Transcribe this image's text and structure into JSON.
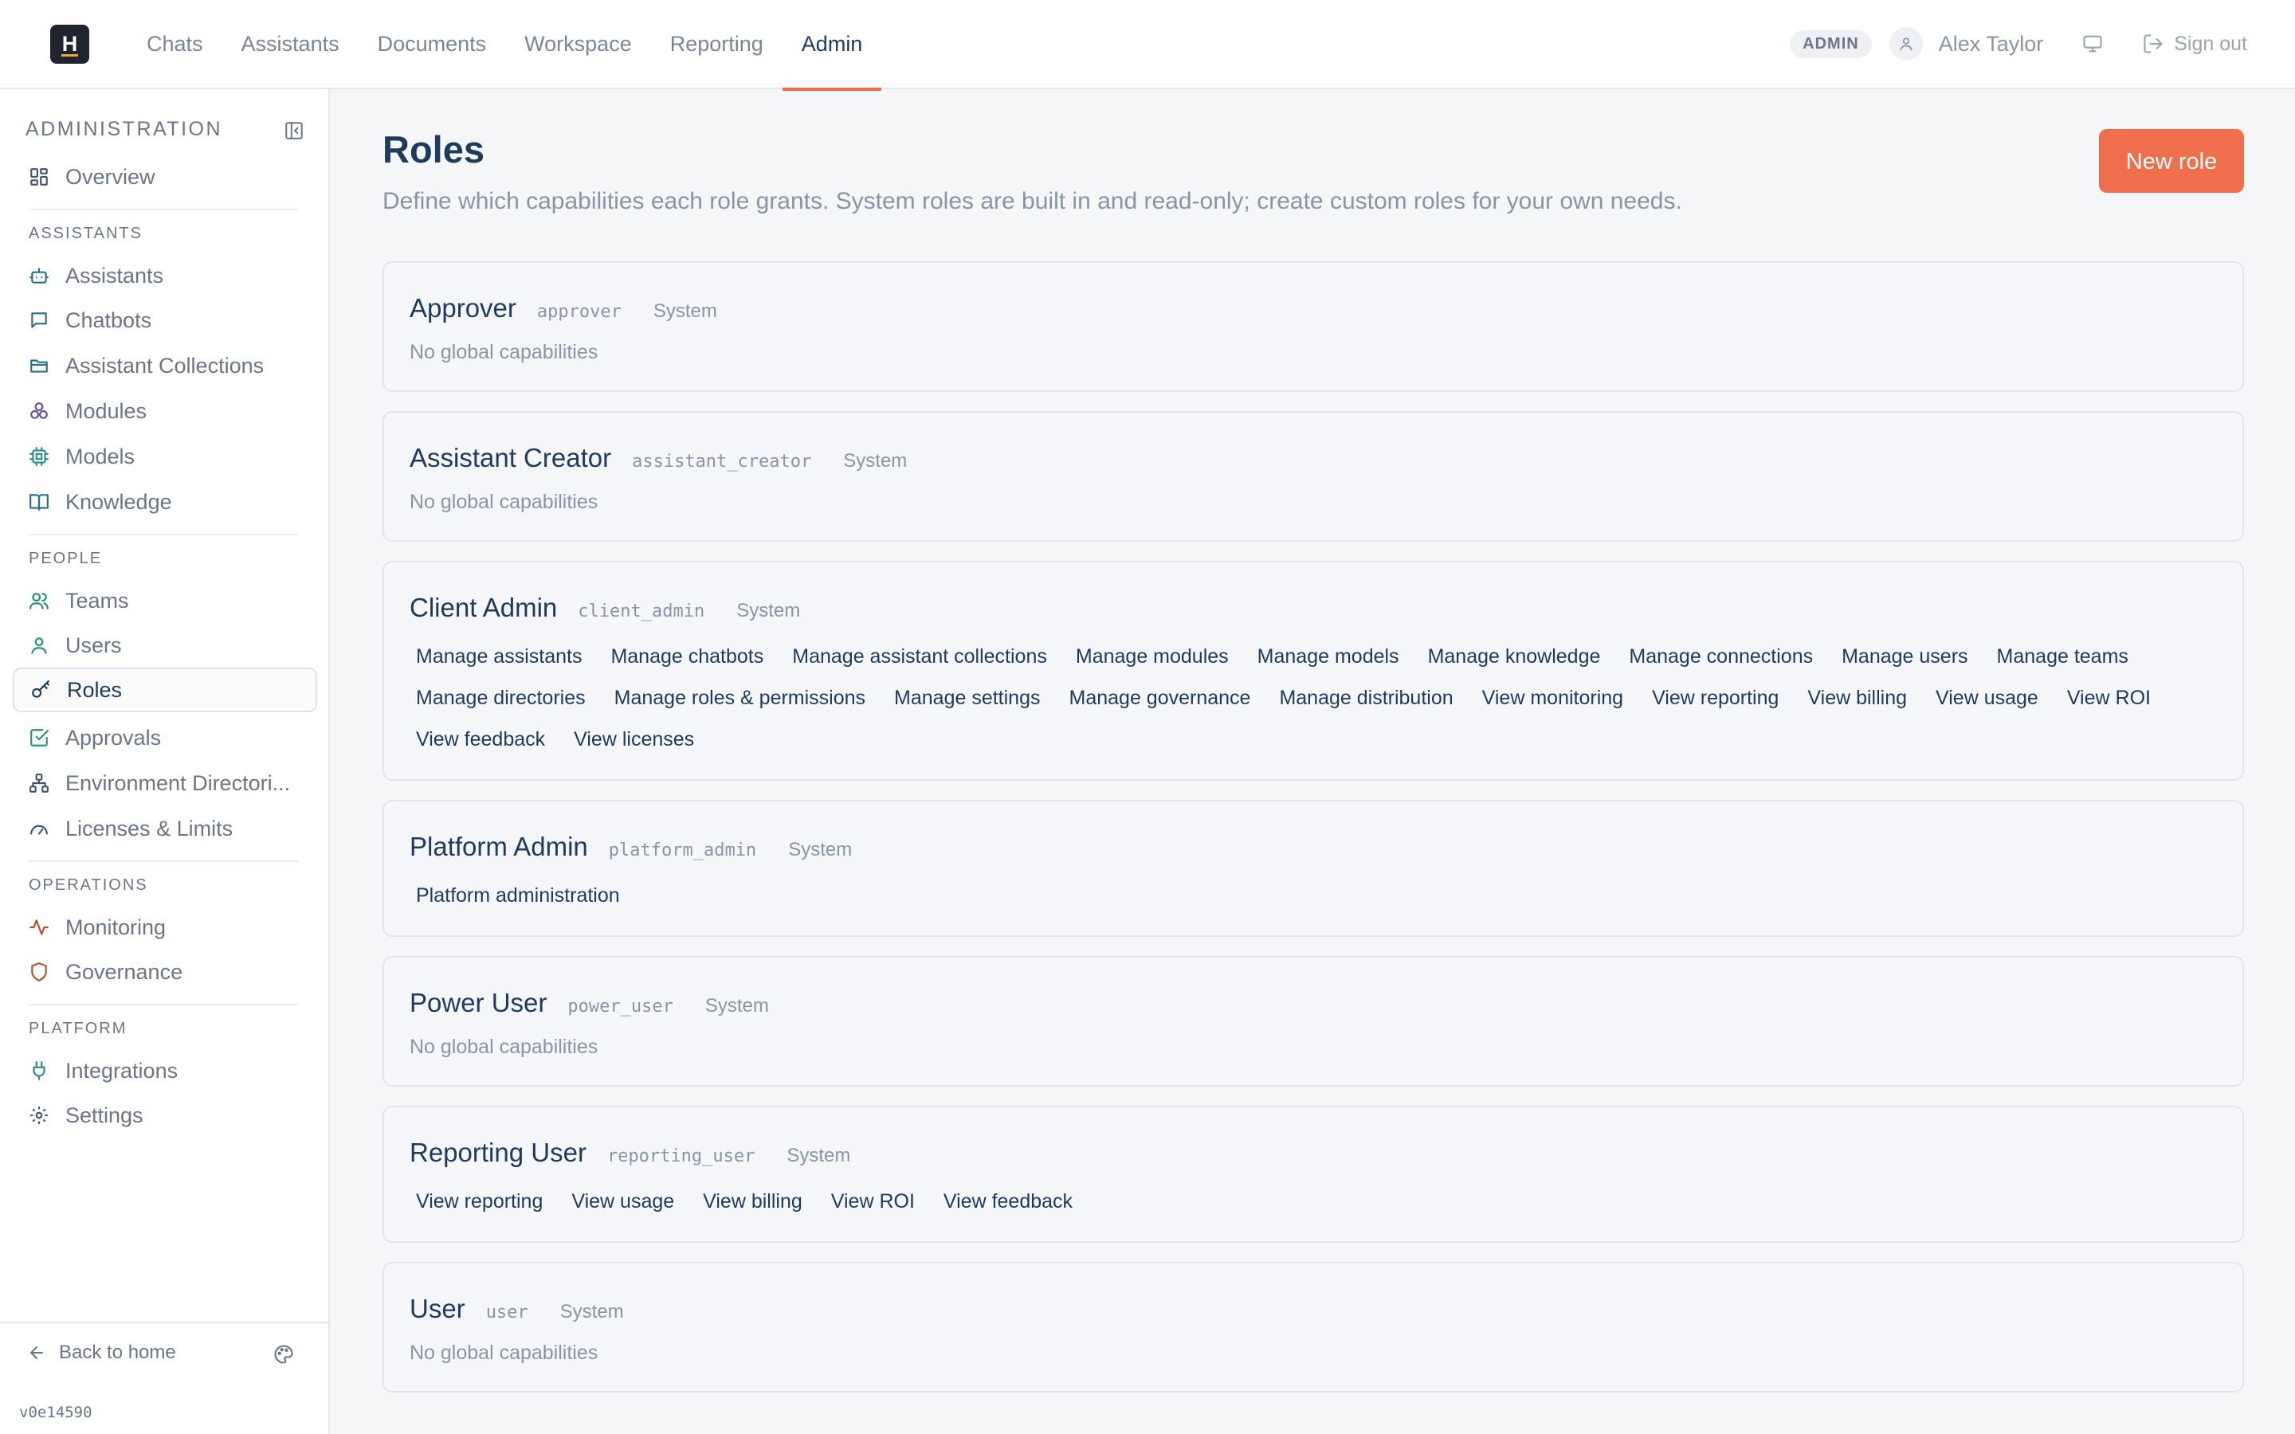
{
  "brand": {
    "logo_letter": "H"
  },
  "nav": {
    "tabs": [
      "Chats",
      "Assistants",
      "Documents",
      "Workspace",
      "Reporting",
      "Admin"
    ],
    "active": "Admin"
  },
  "header_right": {
    "role_chip": "ADMIN",
    "user_name": "Alex Taylor",
    "sign_out": "Sign out"
  },
  "sidebar": {
    "title": "ADMINISTRATION",
    "overview": "Overview",
    "sections": {
      "assistants": "ASSISTANTS",
      "people": "PEOPLE",
      "operations": "OPERATIONS",
      "platform": "PLATFORM"
    },
    "items": {
      "assistants": "Assistants",
      "chatbots": "Chatbots",
      "assistant_collections": "Assistant Collections",
      "modules": "Modules",
      "models": "Models",
      "knowledge": "Knowledge",
      "teams": "Teams",
      "users": "Users",
      "roles": "Roles",
      "approvals": "Approvals",
      "environment_directories": "Environment Directori...",
      "licenses_limits": "Licenses & Limits",
      "monitoring": "Monitoring",
      "governance": "Governance",
      "integrations": "Integrations",
      "settings": "Settings"
    },
    "active_item": "Roles",
    "back_home": "Back to home",
    "version": "v0e14590"
  },
  "main": {
    "title": "Roles",
    "subtitle": "Define which capabilities each role grants. System roles are built in and read-only; create custom roles for your own needs.",
    "new_role_button": "New role",
    "roles": [
      {
        "name": "Approver",
        "key": "approver",
        "type": "System",
        "empty_text": "No global capabilities"
      },
      {
        "name": "Assistant Creator",
        "key": "assistant_creator",
        "type": "System",
        "empty_text": "No global capabilities"
      },
      {
        "name": "Client Admin",
        "key": "client_admin",
        "type": "System",
        "capabilities": [
          [
            "Manage assistants",
            "Manage chatbots",
            "Manage assistant collections",
            "Manage modules",
            "Manage models",
            "Manage knowledge",
            "Manage connections",
            "Manage users",
            "Manage teams"
          ],
          [
            "Manage directories",
            "Manage roles & permissions",
            "Manage settings",
            "Manage governance",
            "Manage distribution",
            "View monitoring",
            "View reporting",
            "View billing",
            "View usage",
            "View ROI"
          ],
          [
            "View feedback",
            "View licenses"
          ]
        ]
      },
      {
        "name": "Platform Admin",
        "key": "platform_admin",
        "type": "System",
        "capabilities": [
          [
            "Platform administration"
          ]
        ]
      },
      {
        "name": "Power User",
        "key": "power_user",
        "type": "System",
        "empty_text": "No global capabilities"
      },
      {
        "name": "Reporting User",
        "key": "reporting_user",
        "type": "System",
        "capabilities": [
          [
            "View reporting",
            "View usage",
            "View billing",
            "View ROI",
            "View feedback"
          ]
        ]
      },
      {
        "name": "User",
        "key": "user",
        "type": "System",
        "empty_text": "No global capabilities"
      }
    ]
  },
  "colors": {
    "accent": "#ef6f4d",
    "text_dark": "#1e3a5f",
    "text_muted": "#8a94a4"
  }
}
